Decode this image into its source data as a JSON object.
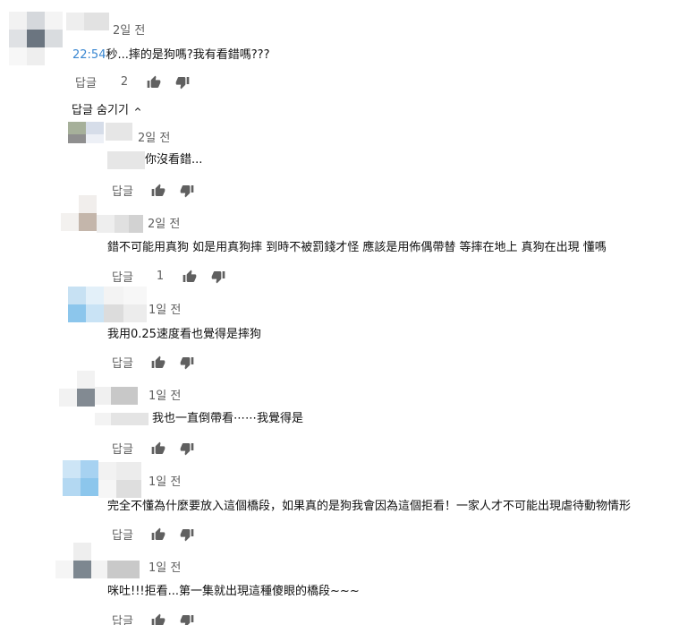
{
  "thread": {
    "main_comment": {
      "time": "2일 전",
      "timestamp": "22:54",
      "text": "秒...摔的是狗嗎?我有看錯嗎???",
      "reply_label": "답글",
      "like_count": "2"
    },
    "hide_replies_label": "답글 숨기기"
  },
  "replies": [
    {
      "time": "2일 전",
      "text": "你沒看錯...",
      "reply_label": "답글",
      "like_count": ""
    },
    {
      "time": "2일 전",
      "text": "錯不可能用真狗 如是用真狗摔 到時不被罰錢才怪 應該是用佈偶帶替 等摔在地上 真狗在出現 懂嗎",
      "reply_label": "답글",
      "like_count": "1"
    },
    {
      "time": "1일 전",
      "text": "我用0.25速度看也覺得是摔狗",
      "reply_label": "답글",
      "like_count": ""
    },
    {
      "time": "1일 전",
      "text": "我也一直倒帶看⋯⋯我覺得是",
      "reply_label": "답글",
      "like_count": ""
    },
    {
      "time": "1일 전",
      "text": "完全不懂為什麼要放入這個橋段，如果真的是狗我會因為這個拒看！一家人才不可能出現虐待動物情形",
      "reply_label": "답글",
      "like_count": ""
    },
    {
      "time": "1일 전",
      "text": "咪吐!!!拒看...第一集就出現這種傻眼的橋段~~~",
      "reply_label": "답글",
      "like_count": ""
    }
  ],
  "colors": {
    "timestamp_link": "#3a87d1",
    "meta_text": "#606060",
    "body_text": "#0f0f0f",
    "icon": "#606060"
  },
  "icons": {
    "like": "thumb-up-icon",
    "dislike": "thumb-down-icon",
    "collapse": "chevron-up-icon"
  }
}
